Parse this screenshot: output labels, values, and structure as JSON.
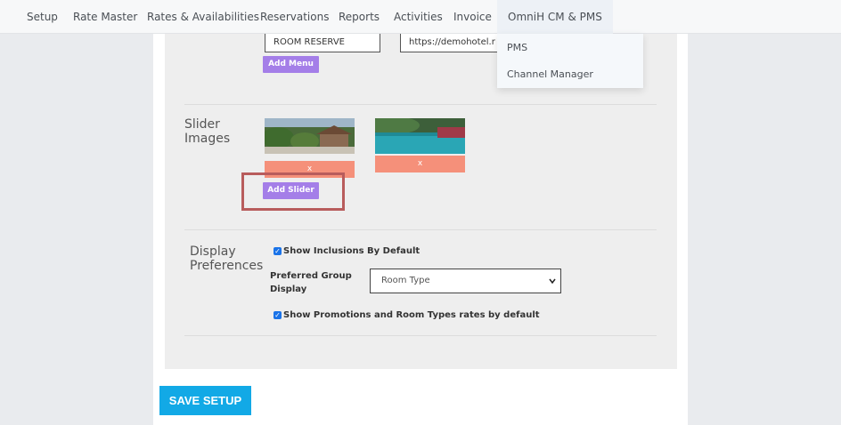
{
  "nav": {
    "items": [
      "Setup",
      "Rate Master",
      "Rates & Availabilities",
      "Reservations",
      "Reports",
      "Activities",
      "Invoice",
      "OmniH CM & PMS"
    ]
  },
  "dropdown": {
    "items": [
      "PMS",
      "Channel Manager"
    ]
  },
  "menu": {
    "name_value": "ROOM RESERVE",
    "url_value": "https://demohotel.r",
    "add_menu_label": "Add Menu"
  },
  "slider": {
    "label_line1": "Slider",
    "label_line2": "Images",
    "remove_label": "x",
    "add_slider_label": "Add Slider"
  },
  "display_prefs": {
    "label_line1": "Display",
    "label_line2": "Preferences",
    "show_inclusions_label": "Show Inclusions By Default",
    "group_label_line1": "Preferred Group",
    "group_label_line2": "Display",
    "group_selected": "Room Type",
    "show_promotions_label": "Show Promotions and Room Types rates by default"
  },
  "save_label": "SAVE SETUP",
  "colors": {
    "accent_purple": "#a47ee8",
    "remove_salmon": "#f5907a",
    "save_blue": "#12a9e6",
    "highlight_red": "#b85c5c"
  }
}
